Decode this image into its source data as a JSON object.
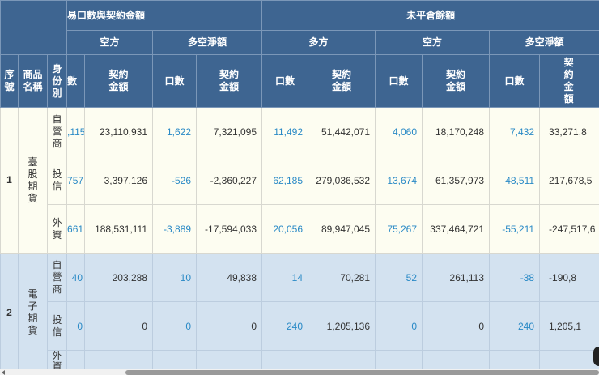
{
  "header": {
    "group_trade": "交易口數與契約金額",
    "group_oi": "未平倉餘額",
    "sub": {
      "short": "空方",
      "net": "多空淨額",
      "long": "多方"
    },
    "col_seq": "序號",
    "col_product": "商品名稱",
    "col_identity": "身份別",
    "col_lots": "口數",
    "col_amount": "契約金額",
    "col_lots_trunc": "數"
  },
  "groups": [
    {
      "seq": "1",
      "product": "臺股期貨",
      "rows": [
        {
          "identity": "自營商",
          "cells": [
            ",115",
            "23,110,931",
            "1,622",
            "7,321,095",
            "11,492",
            "51,442,071",
            "4,060",
            "18,170,248",
            "7,432",
            "33,271,8"
          ]
        },
        {
          "identity": "投信",
          "cells": [
            "757",
            "3,397,126",
            "-526",
            "-2,360,227",
            "62,185",
            "279,036,532",
            "13,674",
            "61,357,973",
            "48,511",
            "217,678,5"
          ]
        },
        {
          "identity": "外資",
          "cells": [
            "661",
            "188,531,111",
            "-3,889",
            "-17,594,033",
            "20,056",
            "89,947,045",
            "75,267",
            "337,464,721",
            "-55,211",
            "-247,517,6"
          ]
        }
      ]
    },
    {
      "seq": "2",
      "product": "電子期貨",
      "rows": [
        {
          "identity": "自營商",
          "cells": [
            "40",
            "203,288",
            "10",
            "49,838",
            "14",
            "70,281",
            "52",
            "261,113",
            "-38",
            "-190,8"
          ]
        },
        {
          "identity": "投信",
          "cells": [
            "0",
            "0",
            "0",
            "0",
            "240",
            "1,205,136",
            "0",
            "0",
            "240",
            "1,205,1"
          ]
        },
        {
          "identity": "外資",
          "cells": [
            "",
            "",
            "",
            "",
            "",
            "",
            "",
            "",
            "",
            ""
          ]
        }
      ]
    }
  ],
  "colors": {
    "header": "#3e6591",
    "lots": "#2a8ac6",
    "row_a": "#fdfdf1",
    "row_b": "#d3e2f0"
  }
}
